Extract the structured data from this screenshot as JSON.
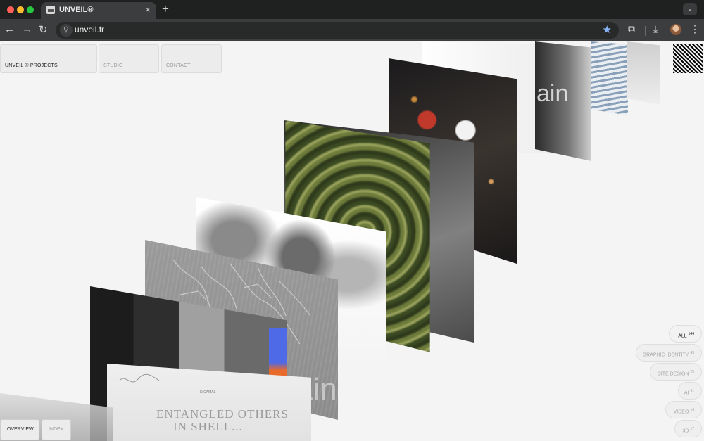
{
  "browser": {
    "tab_title": "UNVEIL®",
    "tab_close": "×",
    "new_tab": "+",
    "tab_menu": "⌄",
    "url": "unveil.fr",
    "nav_back": "←",
    "nav_forward": "→",
    "nav_reload": "↻",
    "site_info": "⚲",
    "bookmark": "★",
    "extensions": "⧉",
    "download": "⤓",
    "menu": "⋮"
  },
  "topnav": {
    "projects": "UNVEIL ® PROJECTS",
    "studio": "STUDIO",
    "contact": "CONTACT"
  },
  "stack_text": {
    "dancer_word": "ain",
    "dark_word": "ain",
    "small_label": "NICAMAL",
    "serif_line1": "ENTANGLED OTHERS",
    "serif_line2": "IN SHELL..."
  },
  "view_tabs": {
    "overview": "OVERVIEW",
    "index": "INDEX"
  },
  "filters": [
    {
      "label": "ALL",
      "count": "144"
    },
    {
      "label": "GRAPHIC IDENTITY",
      "count": "43"
    },
    {
      "label": "SITE DESIGN",
      "count": "25"
    },
    {
      "label": "AI",
      "count": "61"
    },
    {
      "label": "VIDEO",
      "count": "14"
    },
    {
      "label": "3D",
      "count": "17"
    }
  ],
  "colors": {
    "accent_blue": "#4f6ae6",
    "accent_orange": "#e86a2a",
    "background": "#f4f4f4"
  }
}
